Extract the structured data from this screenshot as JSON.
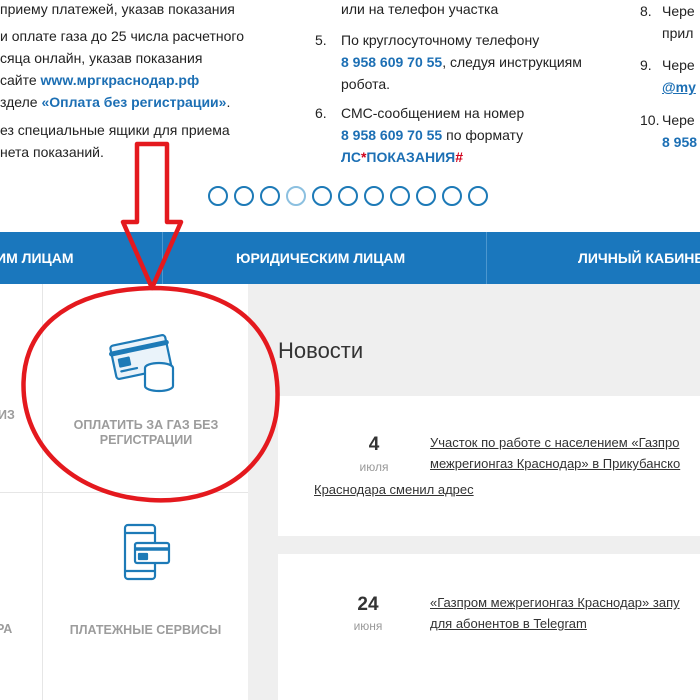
{
  "instructions": {
    "col1": [
      {
        "text": "приему платежей, указав показания"
      },
      {
        "text": "и оплате газа до 25 числа расчетного"
      },
      {
        "text": "сяца онлайн, указав показания"
      },
      {
        "prefix": "сайте ",
        "link": "www.мргкраснодар.рф"
      },
      {
        "prefix": "зделе ",
        "link": "«Оплата без регистрации»",
        "suffix": "."
      },
      {
        "text": "ез специальные ящики для приема"
      },
      {
        "text": "нета показаний."
      }
    ],
    "col2_top": "или на телефон участка",
    "item5": {
      "num": "5.",
      "line1": "По круглосуточному телефону",
      "phone": "8 958 609 70 55",
      "rest": ", следуя инструкциям",
      "line3": "робота."
    },
    "item6": {
      "num": "6.",
      "line1": "СМС-сообщением на номер",
      "phone": "8 958 609 70 55",
      "rest": " по формату",
      "format": "ЛС*ПОКАЗАНИЯ#"
    },
    "col3": [
      {
        "num": "8.",
        "text": "Чере",
        "sub": "прил"
      },
      {
        "num": "9.",
        "text": "Чере",
        "sub": "@my"
      },
      {
        "num": "10.",
        "text": "Чере",
        "sub": "8 958"
      }
    ]
  },
  "carousel": {
    "count": 11,
    "active_index": 3
  },
  "nav": {
    "tab1": "им лицам",
    "tab2": "Юридическим лицам",
    "tab3": "Личный кабинет"
  },
  "tiles": {
    "pay_label": "Оплатить за газ без регистрации",
    "services_label": "Платежные сервисы",
    "left_cut_1": "ИЗ",
    "left_cut_2": "РА"
  },
  "news": {
    "title": "Новости",
    "items": [
      {
        "day": "4",
        "month": "июля",
        "line1": "Участок по работе с населением «Газпро",
        "line2": "межрегионгаз Краснодар» в Прикубанско",
        "line3": "Краснодара сменил адрес"
      },
      {
        "day": "24",
        "month": "июня",
        "line1": "«Газпром межрегионгаз Краснодар» запу",
        "line2": "для абонентов в Telegram"
      }
    ]
  },
  "colors": {
    "nav_blue": "#1a77bd",
    "link_blue": "#1c6fb4",
    "hashtag_red": "#d0021b",
    "annotation_red": "#e4191e"
  },
  "icons": {
    "pay": "card-coins-icon",
    "services": "phone-card-icon",
    "arrow": "down-arrow-annotation",
    "circle": "circle-annotation"
  }
}
